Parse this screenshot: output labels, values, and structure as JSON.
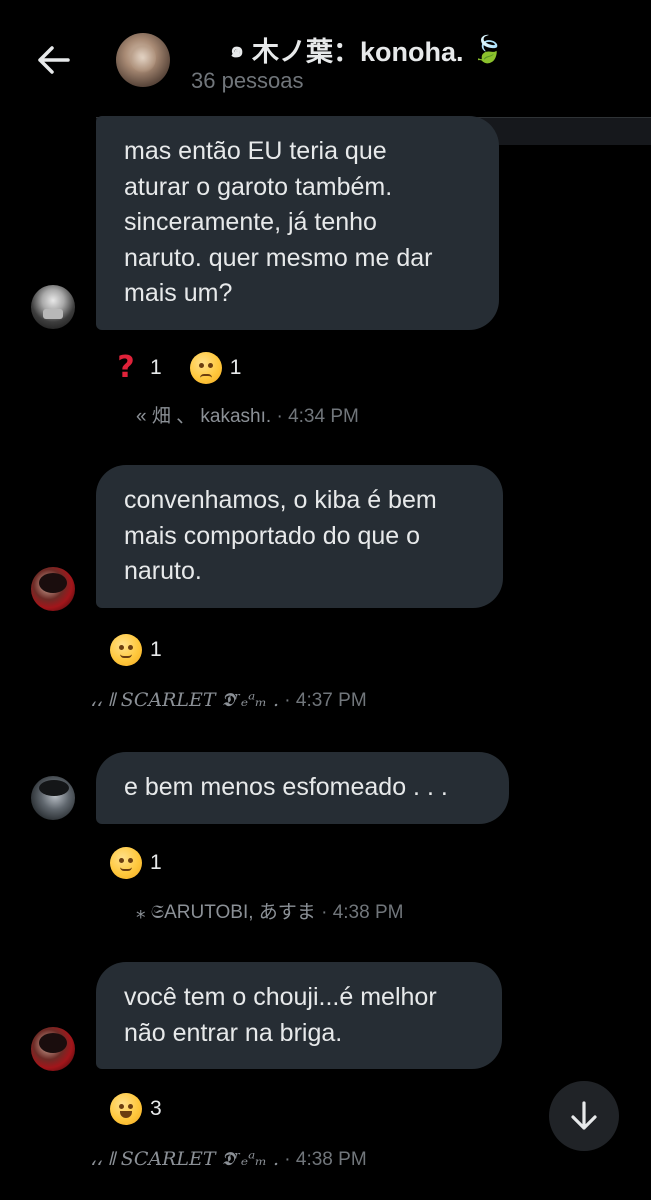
{
  "header": {
    "back_icon": "arrow-left-icon",
    "title_prefix_icon": "spiral-icon",
    "title": "木ノ葉：konoha.",
    "title_suffix_icon": "leaf-icon",
    "members": "36 pessoas"
  },
  "messages": [
    {
      "text": "mas então EU teria que aturar o garoto também. sinceramente, já tenho naruto. quer mesmo me dar mais um?",
      "lines": [
        "mas então EU teria que",
        "aturar o garoto também.",
        "sinceramente, já tenho",
        "naruto. quer mesmo me dar",
        "mais um?"
      ],
      "reactions": [
        {
          "emoji": "❓",
          "icon": "question-mark-icon",
          "count": "1"
        },
        {
          "emoji": "😒",
          "icon": "unamused-face-icon",
          "count": "1"
        }
      ],
      "sender": "«   畑 、 kakashı.",
      "time": "4:34 PM"
    },
    {
      "text": "convenhamos, o kiba é bem mais comportado do que o naruto.",
      "lines": [
        "convenhamos, o kiba é bem",
        "mais comportado do que o",
        "naruto."
      ],
      "reactions": [
        {
          "emoji": "🫡",
          "icon": "saluting-face-icon",
          "count": "1"
        }
      ],
      "sender": "،،  𝍪  SCARLET  𝕯ʳₑᵃₘ .",
      "time": "4:37 PM"
    },
    {
      "text": "e bem menos esfomeado . . .",
      "lines": [
        "e bem menos esfomeado . . ."
      ],
      "reactions": [
        {
          "emoji": "☺️",
          "icon": "smiling-face-icon",
          "count": "1"
        }
      ],
      "sender": "⁎ 𝔖ARUTOBI, あすま",
      "time": "4:38 PM"
    },
    {
      "text": "você tem o chouji...é melhor não entrar na briga.",
      "lines": [
        "você tem o chouji...é melhor",
        "não entrar na briga."
      ],
      "reactions": [
        {
          "emoji": "😂",
          "icon": "tears-of-joy-face-icon",
          "count": "3"
        }
      ],
      "sender": "،،  𝍪  SCARLET  𝕯ʳₑᵃₘ .",
      "time": "4:38 PM"
    }
  ],
  "fab": {
    "icon": "arrow-down-icon"
  },
  "colors": {
    "bubble": "#262d34",
    "background": "#000000",
    "muted": "#71767b"
  }
}
